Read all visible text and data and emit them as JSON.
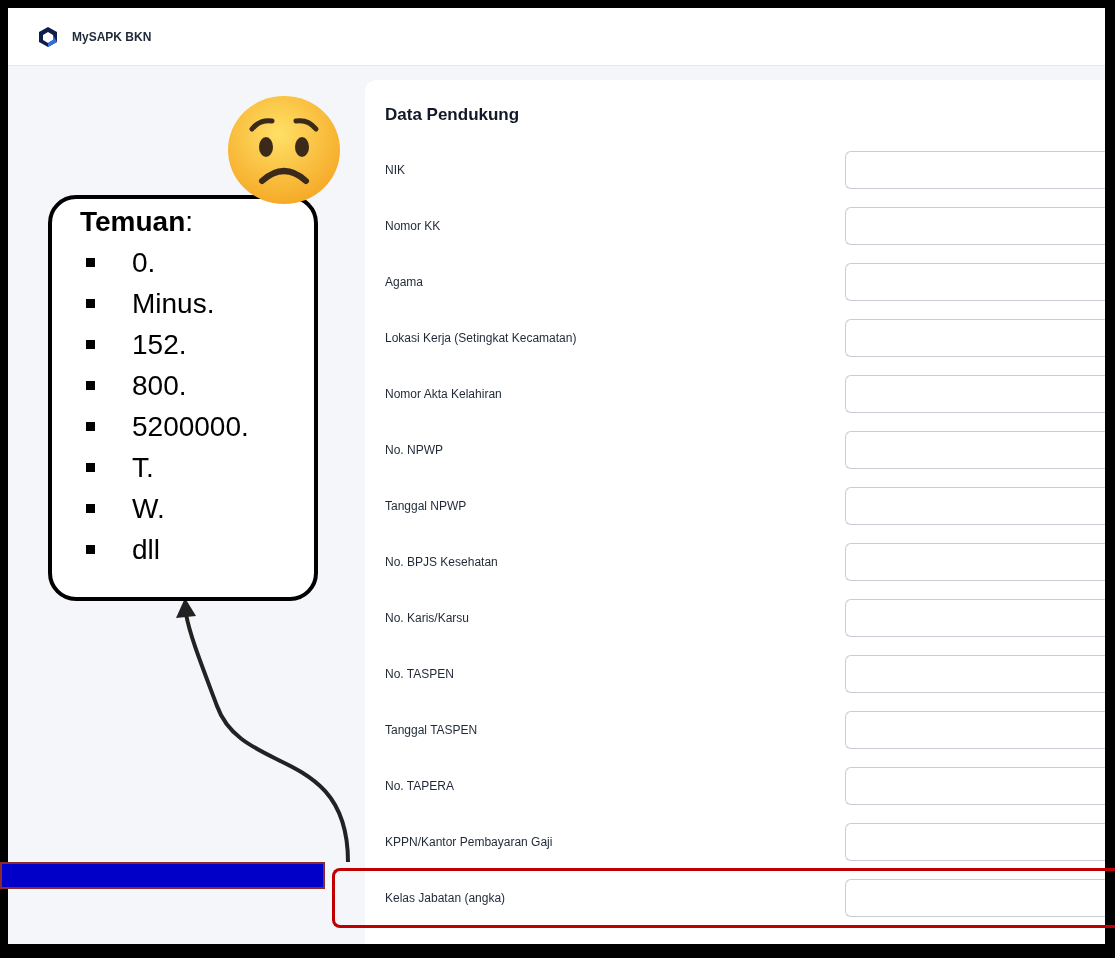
{
  "header": {
    "title": "MySAPK BKN"
  },
  "form": {
    "title": "Data Pendukung",
    "fields": [
      {
        "label": "NIK"
      },
      {
        "label": "Nomor KK"
      },
      {
        "label": "Agama"
      },
      {
        "label": "Lokasi Kerja (Setingkat Kecamatan)"
      },
      {
        "label": "Nomor Akta Kelahiran"
      },
      {
        "label": "No. NPWP"
      },
      {
        "label": "Tanggal NPWP"
      },
      {
        "label": "No. BPJS Kesehatan"
      },
      {
        "label": "No. Karis/Karsu"
      },
      {
        "label": "No. TASPEN"
      },
      {
        "label": "Tanggal TASPEN"
      },
      {
        "label": "No. TAPERA"
      },
      {
        "label": "KPPN/Kantor Pembayaran Gaji"
      },
      {
        "label": "Kelas Jabatan (angka)"
      }
    ]
  },
  "callout": {
    "heading": "**Temuan**:",
    "items": [
      "0.",
      "Minus.",
      "152.",
      "800.",
      "5200000.",
      "T.",
      "W.",
      "dll"
    ]
  }
}
